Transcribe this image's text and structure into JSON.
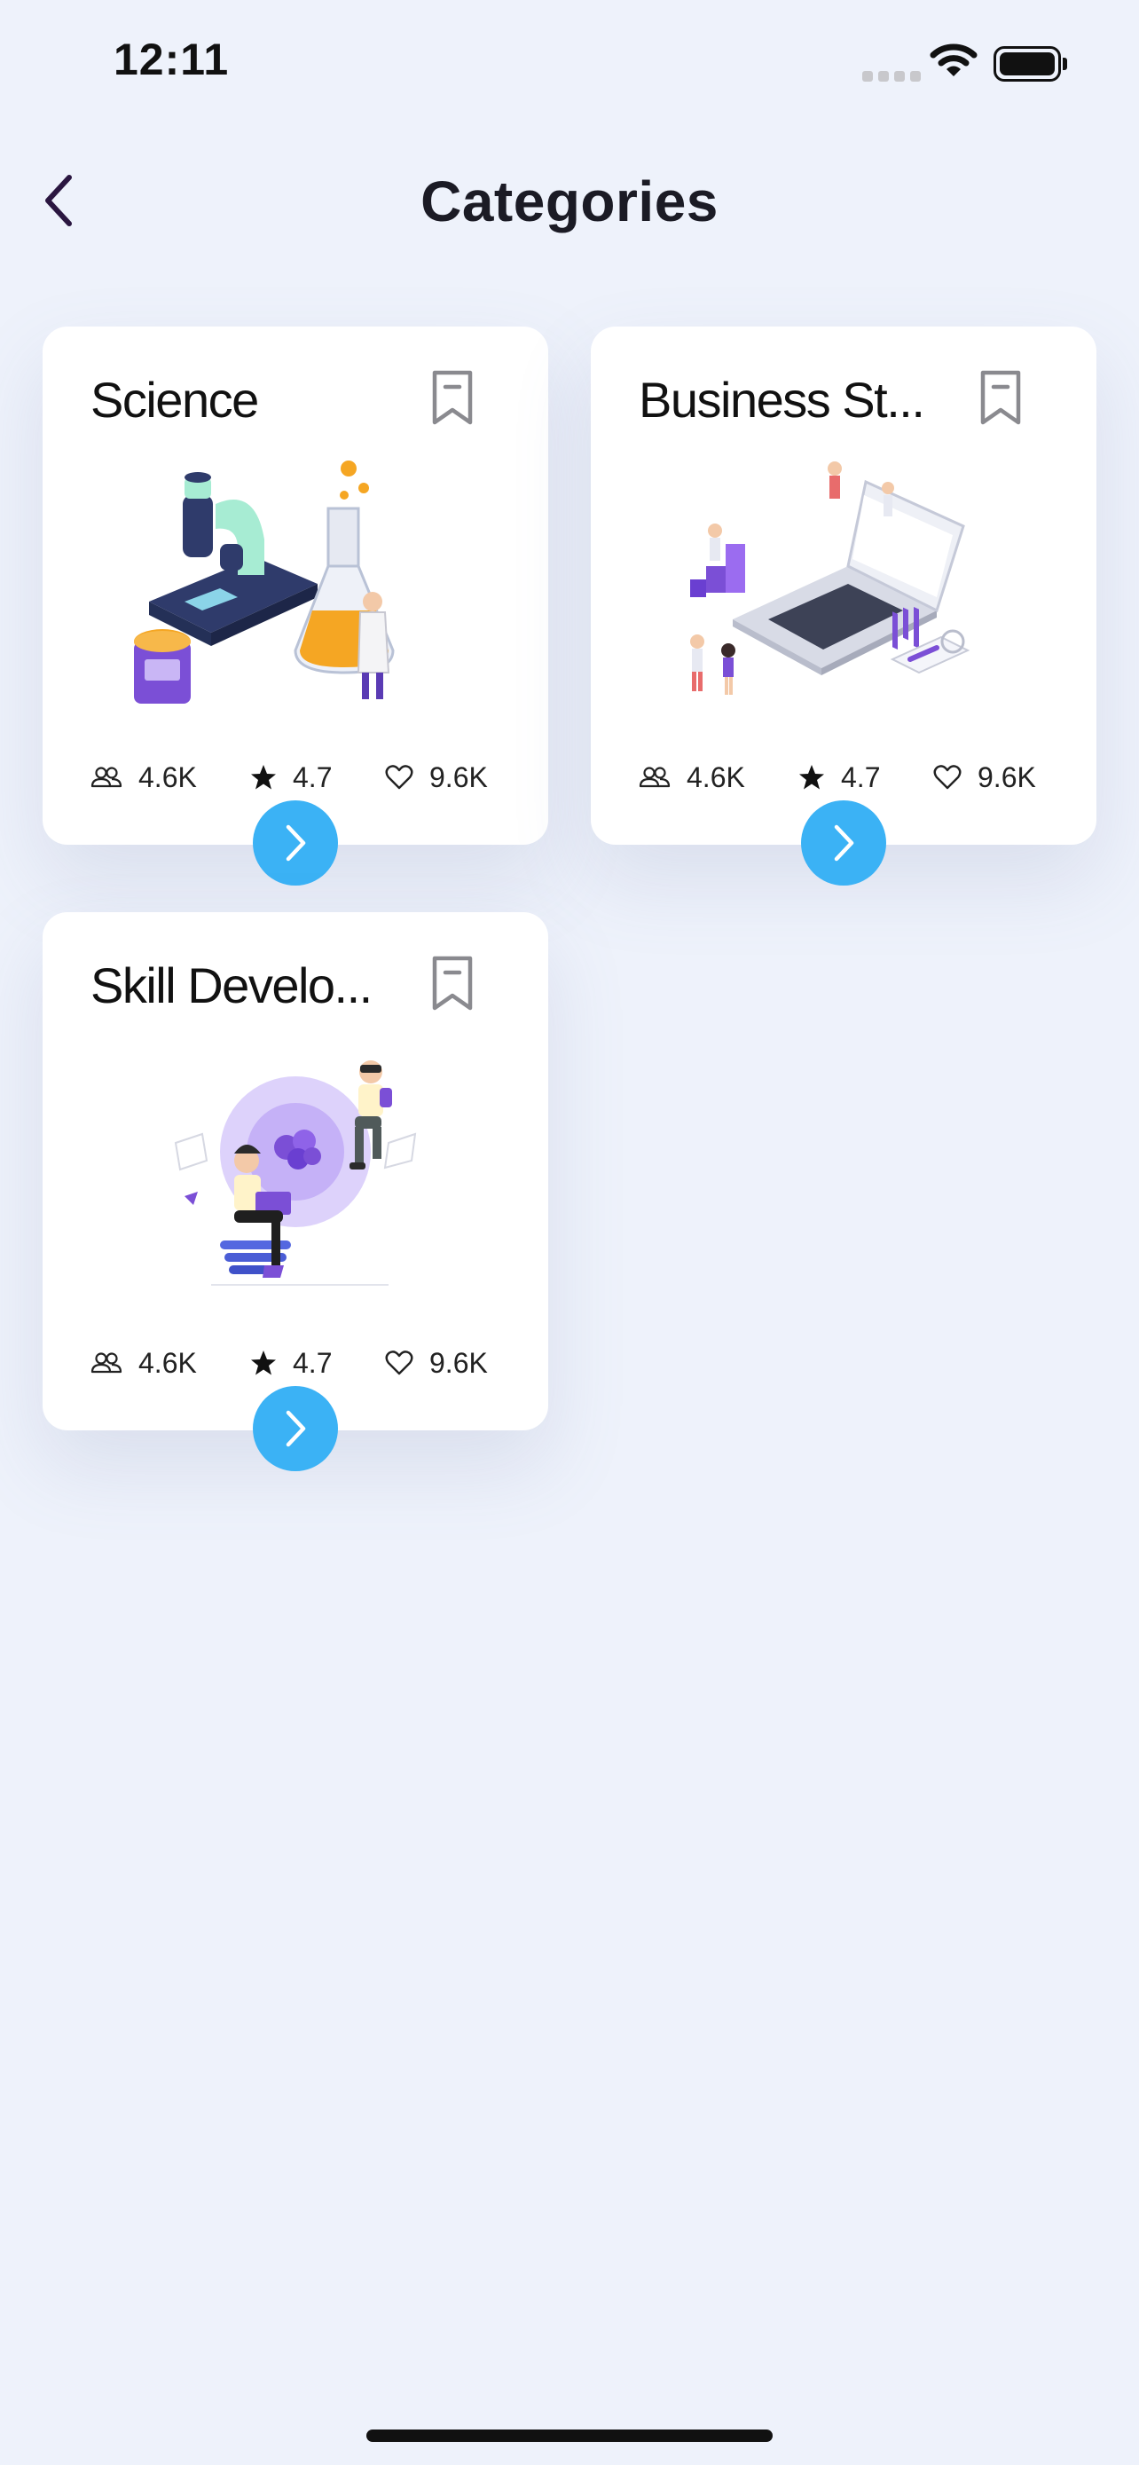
{
  "status_bar": {
    "time": "12:11"
  },
  "header": {
    "title": "Categories"
  },
  "categories": [
    {
      "title": "Science",
      "members": "4.6K",
      "rating": "4.7",
      "likes": "9.6K"
    },
    {
      "title": "Business St...",
      "members": "4.6K",
      "rating": "4.7",
      "likes": "9.6K"
    },
    {
      "title": "Skill Develo...",
      "members": "4.6K",
      "rating": "4.7",
      "likes": "9.6K"
    }
  ],
  "colors": {
    "accent": "#3bb2f5",
    "background": "#eef2fb",
    "card": "#ffffff",
    "title": "#1b1b25"
  },
  "icons": {
    "back": "chevron-left-icon",
    "bookmark": "bookmark-icon",
    "members": "users-icon",
    "rating": "star-icon",
    "likes": "heart-icon",
    "go": "chevron-right-icon"
  }
}
